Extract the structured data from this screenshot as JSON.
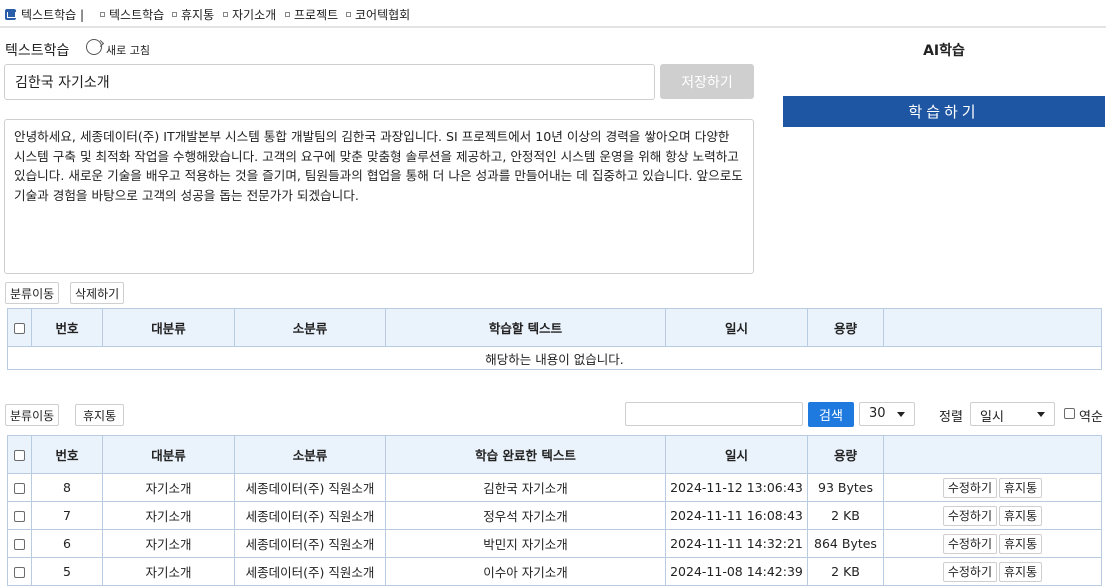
{
  "tabbar": {
    "tabs": [
      {
        "label": "텍스트학습 |"
      },
      {
        "label": "텍스트학습"
      },
      {
        "label": "휴지통"
      },
      {
        "label": "자기소개"
      },
      {
        "label": "프로젝트"
      },
      {
        "label": "코어텍협회"
      }
    ]
  },
  "editor": {
    "title": "텍스트학습",
    "refresh_label": "새로 고침",
    "title_value": "김한국 자기소개",
    "save_label": "저장하기",
    "content": "안녕하세요, 세종데이터(주) IT개발본부 시스템 통합 개발팀의 김한국 과장입니다. SI 프로젝트에서 10년 이상의 경력을 쌓아오며 다양한 시스템 구축 및 최적화 작업을 수행해왔습니다. 고객의 요구에 맞춘 맞춤형 솔루션을 제공하고, 안정적인 시스템 운영을 위해 항상 노력하고 있습니다. 새로운 기술을 배우고 적용하는 것을 즐기며, 팀원들과의 협업을 통해 더 나은 성과를 만들어내는 데 집중하고 있습니다. 앞으로도 기술과 경험을 바탕으로 고객의 성공을 돕는 전문가가 되겠습니다."
  },
  "ai": {
    "title": "AI학습",
    "learn_label": "학습하기"
  },
  "pending": {
    "move_label": "분류이동",
    "delete_label": "삭제하기",
    "headers": [
      "번호",
      "대분류",
      "소분류",
      "학습할 텍스트",
      "일시",
      "용량"
    ],
    "empty_text": "해당하는 내용이 없습니다."
  },
  "completed": {
    "move_label": "분류이동",
    "trash_label": "휴지통",
    "search_label": "검색",
    "search_value": "",
    "page_size": "30",
    "sort_label": "정렬",
    "sort_value": "일시",
    "reverse_label": "역순",
    "edit_label": "수정하기",
    "row_trash_label": "휴지통",
    "headers": [
      "번호",
      "대분류",
      "소분류",
      "학습 완료한 텍스트",
      "일시",
      "용량"
    ],
    "rows": [
      {
        "no": "8",
        "major": "자기소개",
        "minor": "세종데이터(주) 직원소개",
        "text": "김한국 자기소개",
        "date": "2024-11-12 13:06:43",
        "size": "93 Bytes"
      },
      {
        "no": "7",
        "major": "자기소개",
        "minor": "세종데이터(주) 직원소개",
        "text": "정우석 자기소개",
        "date": "2024-11-11 16:08:43",
        "size": "2 KB"
      },
      {
        "no": "6",
        "major": "자기소개",
        "minor": "세종데이터(주) 직원소개",
        "text": "박민지 자기소개",
        "date": "2024-11-11 14:32:21",
        "size": "864 Bytes"
      },
      {
        "no": "5",
        "major": "자기소개",
        "minor": "세종데이터(주) 직원소개",
        "text": "이수아 자기소개",
        "date": "2024-11-08 14:42:39",
        "size": "2 KB"
      }
    ]
  }
}
